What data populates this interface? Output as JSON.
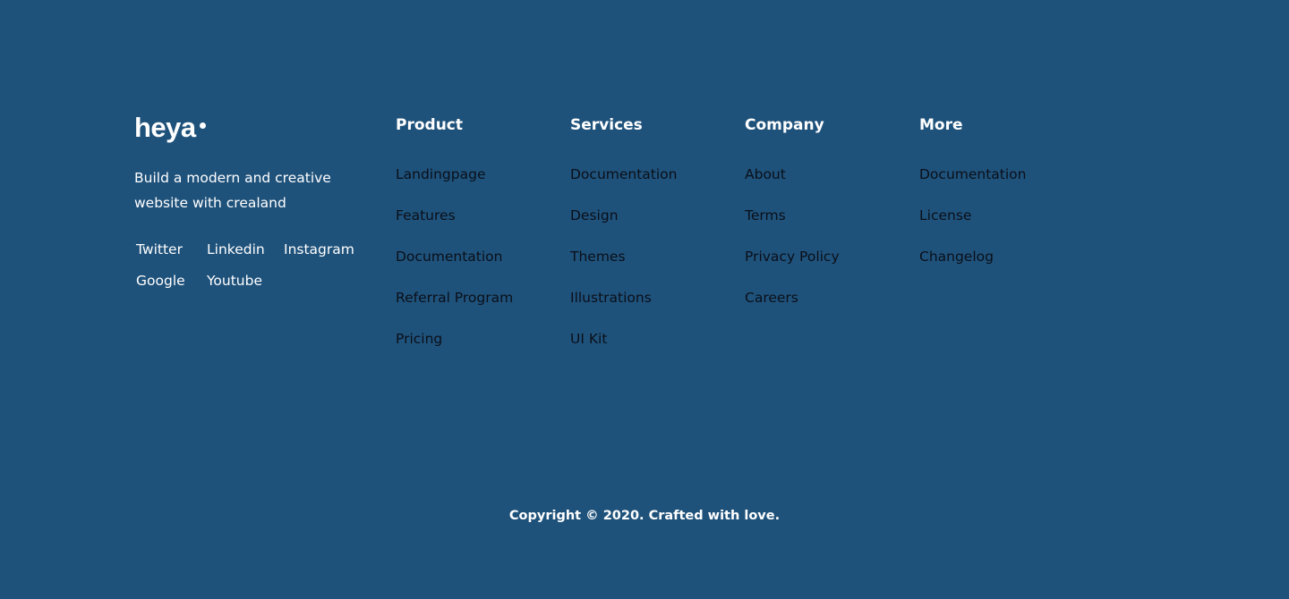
{
  "brand": {
    "logo_text": "heya",
    "tagline": "Build a modern and creative website with crealand"
  },
  "social": {
    "twitter": "Twitter",
    "linkedin": "Linkedin",
    "instagram": "Instagram",
    "google": "Google",
    "youtube": "Youtube"
  },
  "columns": [
    {
      "heading": "Product",
      "links": [
        "Landingpage",
        "Features",
        "Documentation",
        "Referral Program",
        "Pricing"
      ]
    },
    {
      "heading": "Services",
      "links": [
        "Documentation",
        "Design",
        "Themes",
        "Illustrations",
        "UI Kit"
      ]
    },
    {
      "heading": "Company",
      "links": [
        "About",
        "Terms",
        "Privacy Policy",
        "Careers"
      ]
    },
    {
      "heading": "More",
      "links": [
        "Documentation",
        "License",
        "Changelog"
      ]
    }
  ],
  "copyright": "Copyright © 2020. Crafted with love.",
  "colors": {
    "background": "#1f527b",
    "heading_text": "#ffffff",
    "link_text": "#0a0f19"
  }
}
